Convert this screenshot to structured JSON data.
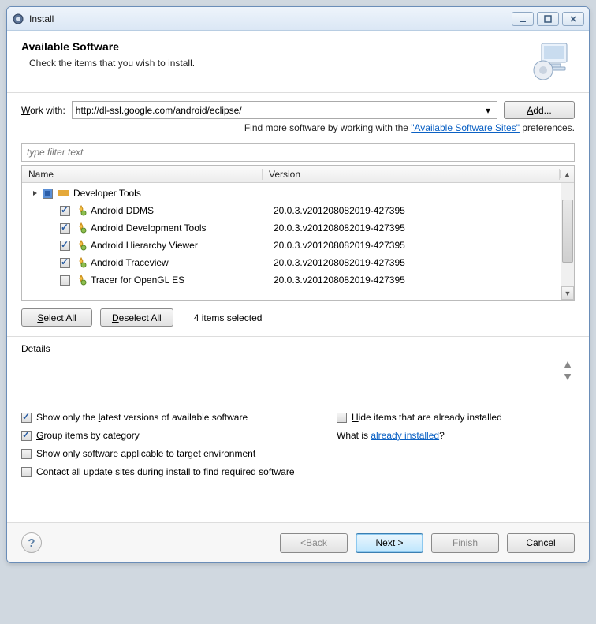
{
  "window": {
    "title": "Install"
  },
  "header": {
    "title": "Available Software",
    "subtitle": "Check the items that you wish to install."
  },
  "workwith": {
    "label_pre": "W",
    "label_post": "ork with:",
    "value": "http://dl-ssl.google.com/android/eclipse/",
    "add_pre": "A",
    "add_post": "dd..."
  },
  "findmore": {
    "prefix": "Find more software by working with the ",
    "link": "\"Available Software Sites\"",
    "suffix": " preferences."
  },
  "filter": {
    "placeholder": "type filter text"
  },
  "tree": {
    "headers": {
      "name": "Name",
      "version": "Version"
    },
    "parent": {
      "label": "Developer Tools"
    },
    "items": [
      {
        "checked": true,
        "name": "Android DDMS",
        "version": "20.0.3.v201208082019-427395"
      },
      {
        "checked": true,
        "name": "Android Development Tools",
        "version": "20.0.3.v201208082019-427395"
      },
      {
        "checked": true,
        "name": "Android Hierarchy Viewer",
        "version": "20.0.3.v201208082019-427395"
      },
      {
        "checked": true,
        "name": "Android Traceview",
        "version": "20.0.3.v201208082019-427395"
      },
      {
        "checked": false,
        "name": "Tracer for OpenGL ES",
        "version": "20.0.3.v201208082019-427395"
      }
    ]
  },
  "selection": {
    "select_all_pre": "S",
    "select_all_post": "elect All",
    "deselect_all_pre": "D",
    "deselect_all_post": "eselect All",
    "count_text": "4 items selected"
  },
  "details": {
    "label": "Details"
  },
  "options": {
    "row1_left_pre": "Show only the ",
    "row1_left_u": "l",
    "row1_left_post": "atest versions of available software",
    "row1_right_pre": "H",
    "row1_right_post": "ide items that are already installed",
    "row2_left_pre": "G",
    "row2_left_post": "roup items by category",
    "row2_right_prefix": "What is ",
    "row2_right_link": "already installed",
    "row2_right_suffix": "?",
    "row3_text": "Show only software applicable to target environment",
    "row4_pre": "C",
    "row4_post": "ontact all update sites during install to find required software"
  },
  "buttons": {
    "back_pre": "< ",
    "back_u": "B",
    "back_post": "ack",
    "next_pre": "N",
    "next_post": "ext >",
    "finish_pre": "F",
    "finish_post": "inish",
    "cancel": "Cancel"
  }
}
